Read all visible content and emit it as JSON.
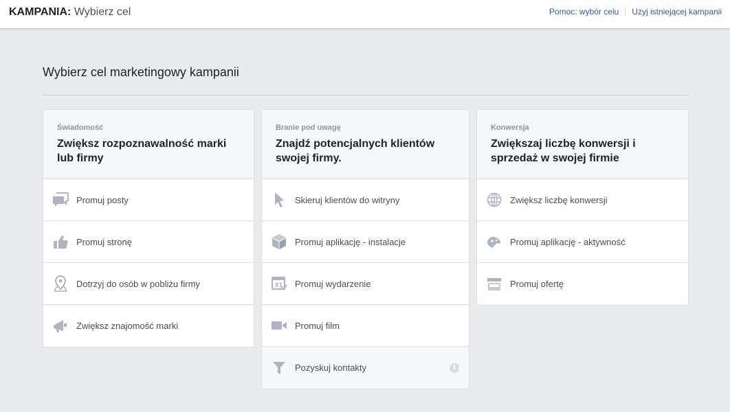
{
  "header": {
    "title_bold": "KAMPANIA:",
    "title_rest": "Wybierz cel",
    "links": [
      "Pomoc: wybór celu",
      "Użyj istniejącej kampanii"
    ]
  },
  "heading": "Wybierz cel marketingowy kampanii",
  "columns": [
    {
      "category": "Świadomość",
      "goal": "Zwiększ rozpoznawalność marki lub firmy",
      "items": [
        {
          "label": "Promuj posty",
          "icon": "comments-icon"
        },
        {
          "label": "Promuj stronę",
          "icon": "thumbs-up-icon"
        },
        {
          "label": "Dotrzyj do osób w pobliżu firmy",
          "icon": "location-pin-icon"
        },
        {
          "label": "Zwiększ znajomość marki",
          "icon": "megaphone-icon"
        }
      ]
    },
    {
      "category": "Branie pod uwagę",
      "goal": "Znajdź potencjalnych klientów swojej firmy.",
      "items": [
        {
          "label": "Skieruj klientów do witryny",
          "icon": "cursor-icon"
        },
        {
          "label": "Promuj aplikację - instalacje",
          "icon": "app-box-icon"
        },
        {
          "label": "Promuj wydarzenie",
          "icon": "calendar-icon",
          "icon_text": "31"
        },
        {
          "label": "Promuj film",
          "icon": "video-camera-icon"
        },
        {
          "label": "Pozyskuj kontakty",
          "icon": "funnel-icon",
          "info": "i"
        }
      ]
    },
    {
      "category": "Konwersja",
      "goal": "Zwiększaj liczbę konwersji i sprzedaż w swojej firmie",
      "items": [
        {
          "label": "Zwiększ liczbę konwersji",
          "icon": "globe-icon"
        },
        {
          "label": "Promuj aplikację - aktywność",
          "icon": "gamepad-icon"
        },
        {
          "label": "Promuj ofertę",
          "icon": "store-icon"
        }
      ]
    }
  ],
  "colors": {
    "icon": "#aeb4c0",
    "link": "#365899",
    "background": "#e9ebee"
  }
}
